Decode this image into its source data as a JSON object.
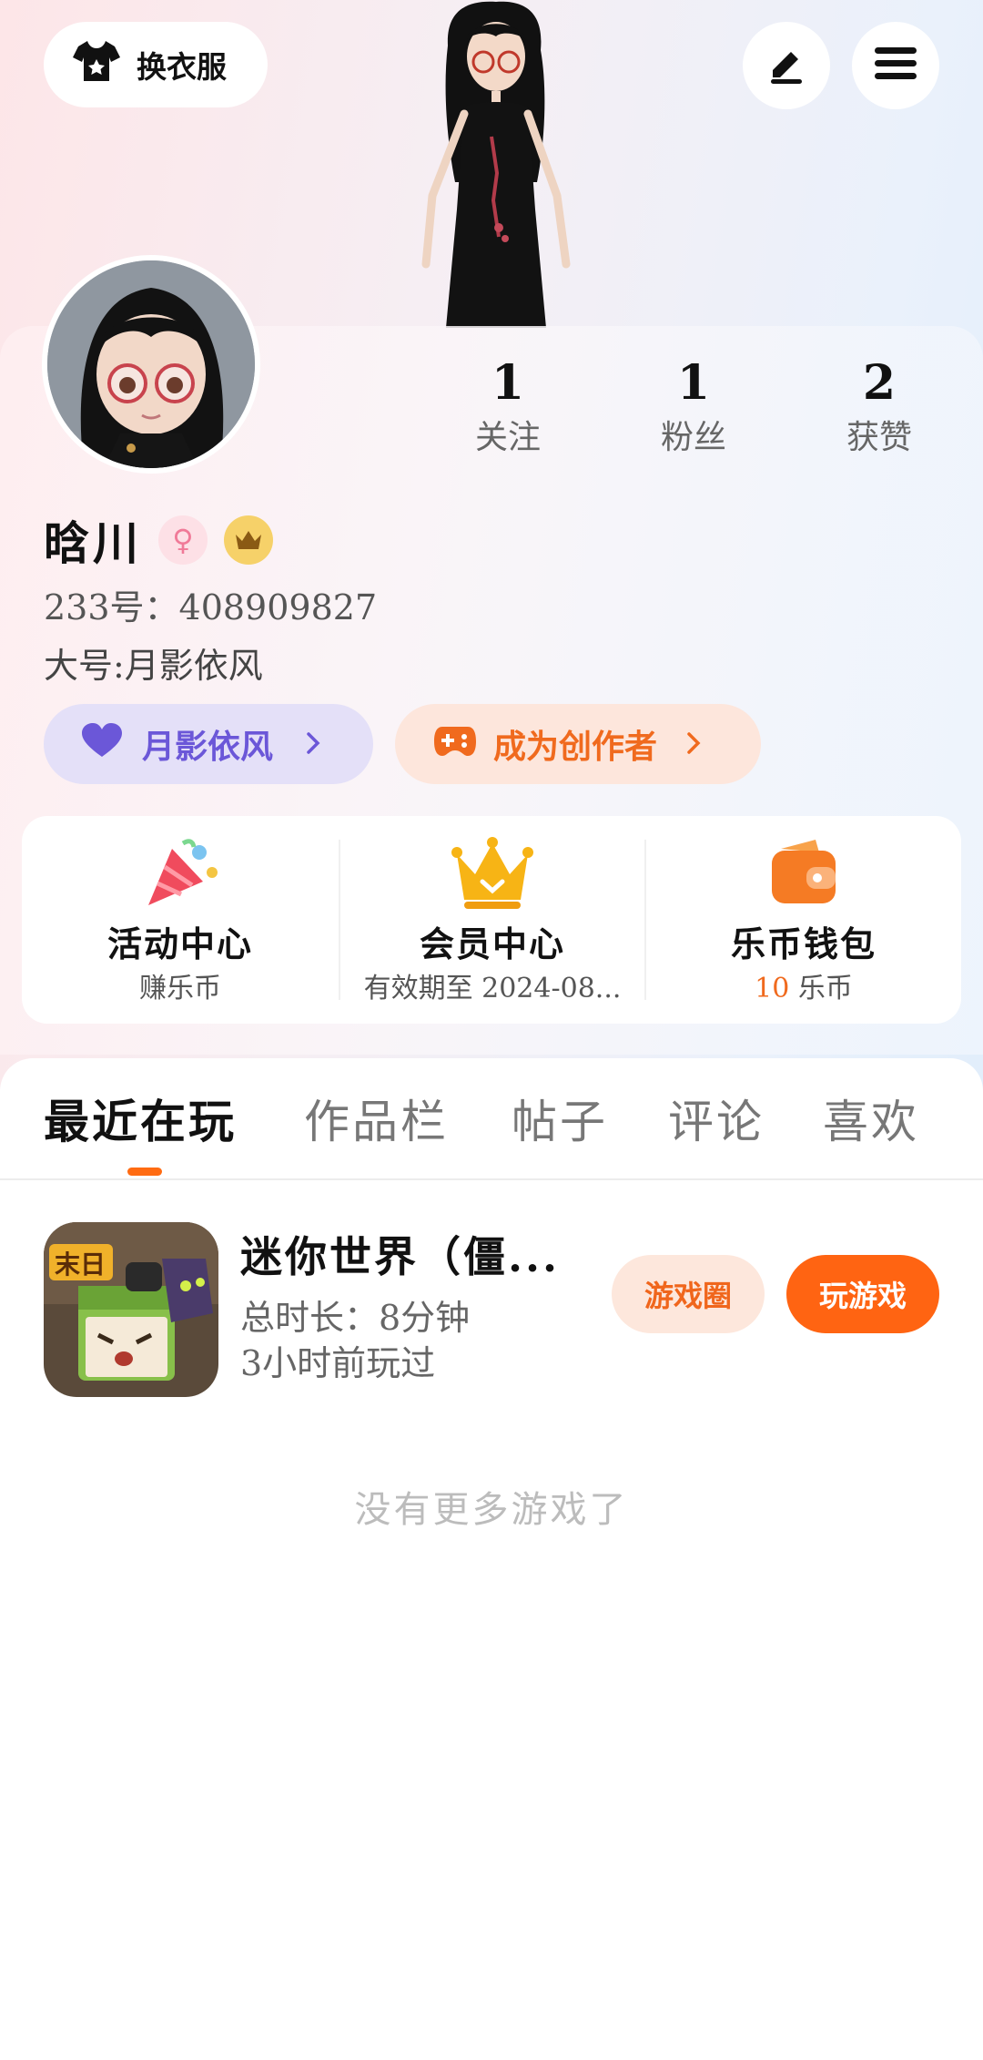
{
  "header": {
    "outfit_label": "换衣服",
    "edit_icon": "pencil-icon",
    "menu_icon": "menu-icon"
  },
  "stats": [
    {
      "value": "1",
      "label": "关注"
    },
    {
      "value": "1",
      "label": "粉丝"
    },
    {
      "value": "2",
      "label": "获赞"
    }
  ],
  "profile": {
    "name": "晗川",
    "gender_badge": "♀",
    "id_line": "233号：408909827",
    "alt_account": "大号:月影依风",
    "linked_pill": "月影依风",
    "creator_pill": "成为创作者"
  },
  "features": [
    {
      "title": "活动中心",
      "subtitle": "赚乐币",
      "icon": "party-popper-icon"
    },
    {
      "title": "会员中心",
      "subtitle": "有效期至 2024-08...",
      "icon": "crown-icon"
    },
    {
      "title": "乐币钱包",
      "subtitle_value": "10",
      "subtitle_unit": "乐币",
      "icon": "wallet-icon"
    }
  ],
  "tabs": [
    "最近在玩",
    "作品栏",
    "帖子",
    "评论",
    "喜欢"
  ],
  "games": [
    {
      "name": "迷你世界（僵...",
      "total_time": "总时长：8分钟",
      "last_played": "3小时前玩过",
      "circle_button": "游戏圈",
      "play_button": "玩游戏",
      "icon_text": "末日"
    }
  ],
  "footer_note": "没有更多游戏了",
  "colors": {
    "accent_orange": "#ff6412",
    "accent_purple": "#6b57d8"
  }
}
